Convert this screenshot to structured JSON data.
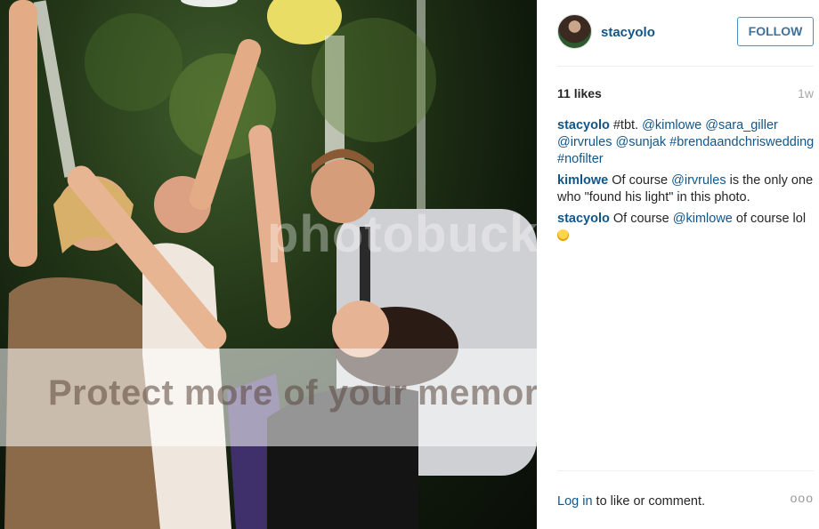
{
  "post": {
    "username": "stacyolo",
    "follow_label": "FOLLOW",
    "likes": "11 likes",
    "time_ago": "1w"
  },
  "photo": {
    "watermark_logo": "photobucket",
    "watermark_text": "Protect more of your memories"
  },
  "comments": [
    {
      "user": "stacyolo",
      "parts": [
        {
          "text": " #tbt. ",
          "link": false
        },
        {
          "text": "@kimlowe",
          "link": true
        },
        {
          "text": " ",
          "link": false
        },
        {
          "text": "@sara_giller",
          "link": true
        },
        {
          "text": " ",
          "link": false
        },
        {
          "text": "@irvrules",
          "link": true
        },
        {
          "text": " ",
          "link": false
        },
        {
          "text": "@sunjak",
          "link": true
        },
        {
          "text": " ",
          "link": false
        },
        {
          "text": "#brendaandchriswedding",
          "link": true
        },
        {
          "text": " ",
          "link": false
        },
        {
          "text": "#nofilter",
          "link": true
        }
      ]
    },
    {
      "user": "kimlowe",
      "parts": [
        {
          "text": " Of course ",
          "link": false
        },
        {
          "text": "@irvrules",
          "link": true
        },
        {
          "text": " is the only one who \"found his light\" in this photo.",
          "link": false
        }
      ]
    },
    {
      "user": "stacyolo",
      "parts": [
        {
          "text": " Of course ",
          "link": false
        },
        {
          "text": "@kimlowe",
          "link": true
        },
        {
          "text": " of course lol ",
          "link": false
        }
      ],
      "emoji": "grinning-face-emoji"
    }
  ],
  "footer": {
    "login_link": "Log in",
    "login_rest": " to like or comment.",
    "more_icon": "ellipsis-icon",
    "more_glyph": "ooo"
  },
  "colors": {
    "link": "#125688",
    "follow_border": "#4990c7",
    "follow_text": "#3f729b",
    "muted": "#a5a7aa"
  }
}
